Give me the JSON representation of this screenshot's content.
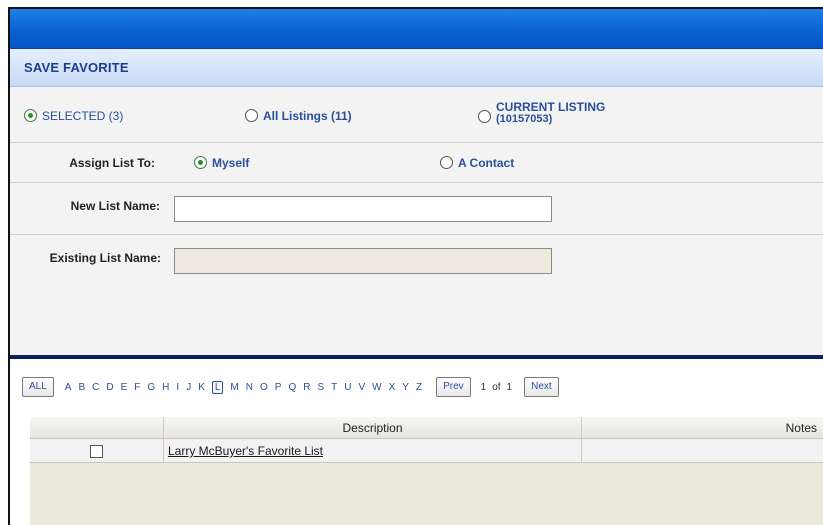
{
  "dialog": {
    "title": "SAVE FAVORITE"
  },
  "scope": {
    "options": [
      {
        "label": "SELECTED (3)",
        "selected": true
      },
      {
        "label": "All Listings (11)",
        "selected": false
      },
      {
        "label_line1": "CURRENT LISTING",
        "label_line2": "(10157053)",
        "selected": false
      }
    ]
  },
  "assign": {
    "label": "Assign List To:",
    "options": [
      {
        "label": "Myself",
        "selected": true
      },
      {
        "label": "A Contact",
        "selected": false
      }
    ]
  },
  "new_list": {
    "label": "New List Name:",
    "value": ""
  },
  "existing_list": {
    "label": "Existing List Name:",
    "value": ""
  },
  "alpha_filter": {
    "all_label": "ALL",
    "letters": [
      "A",
      "B",
      "C",
      "D",
      "E",
      "F",
      "G",
      "H",
      "I",
      "J",
      "K",
      "L",
      "M",
      "N",
      "O",
      "P",
      "Q",
      "R",
      "S",
      "T",
      "U",
      "V",
      "W",
      "X",
      "Y",
      "Z"
    ],
    "selected_letter": "L"
  },
  "pager": {
    "prev_label": "Prev",
    "current": "1",
    "of_label": "of",
    "total": "1",
    "next_label": "Next"
  },
  "grid": {
    "columns": [
      "",
      "Description",
      "Notes"
    ],
    "rows": [
      {
        "checked": false,
        "description": "Larry McBuyer's Favorite List",
        "notes": ""
      }
    ]
  },
  "colors": {
    "topbar": "#0a5fd0",
    "title_text": "#1a3f8f",
    "radio_selected": "#2e8b2e",
    "divider": "#0e1f5a"
  }
}
